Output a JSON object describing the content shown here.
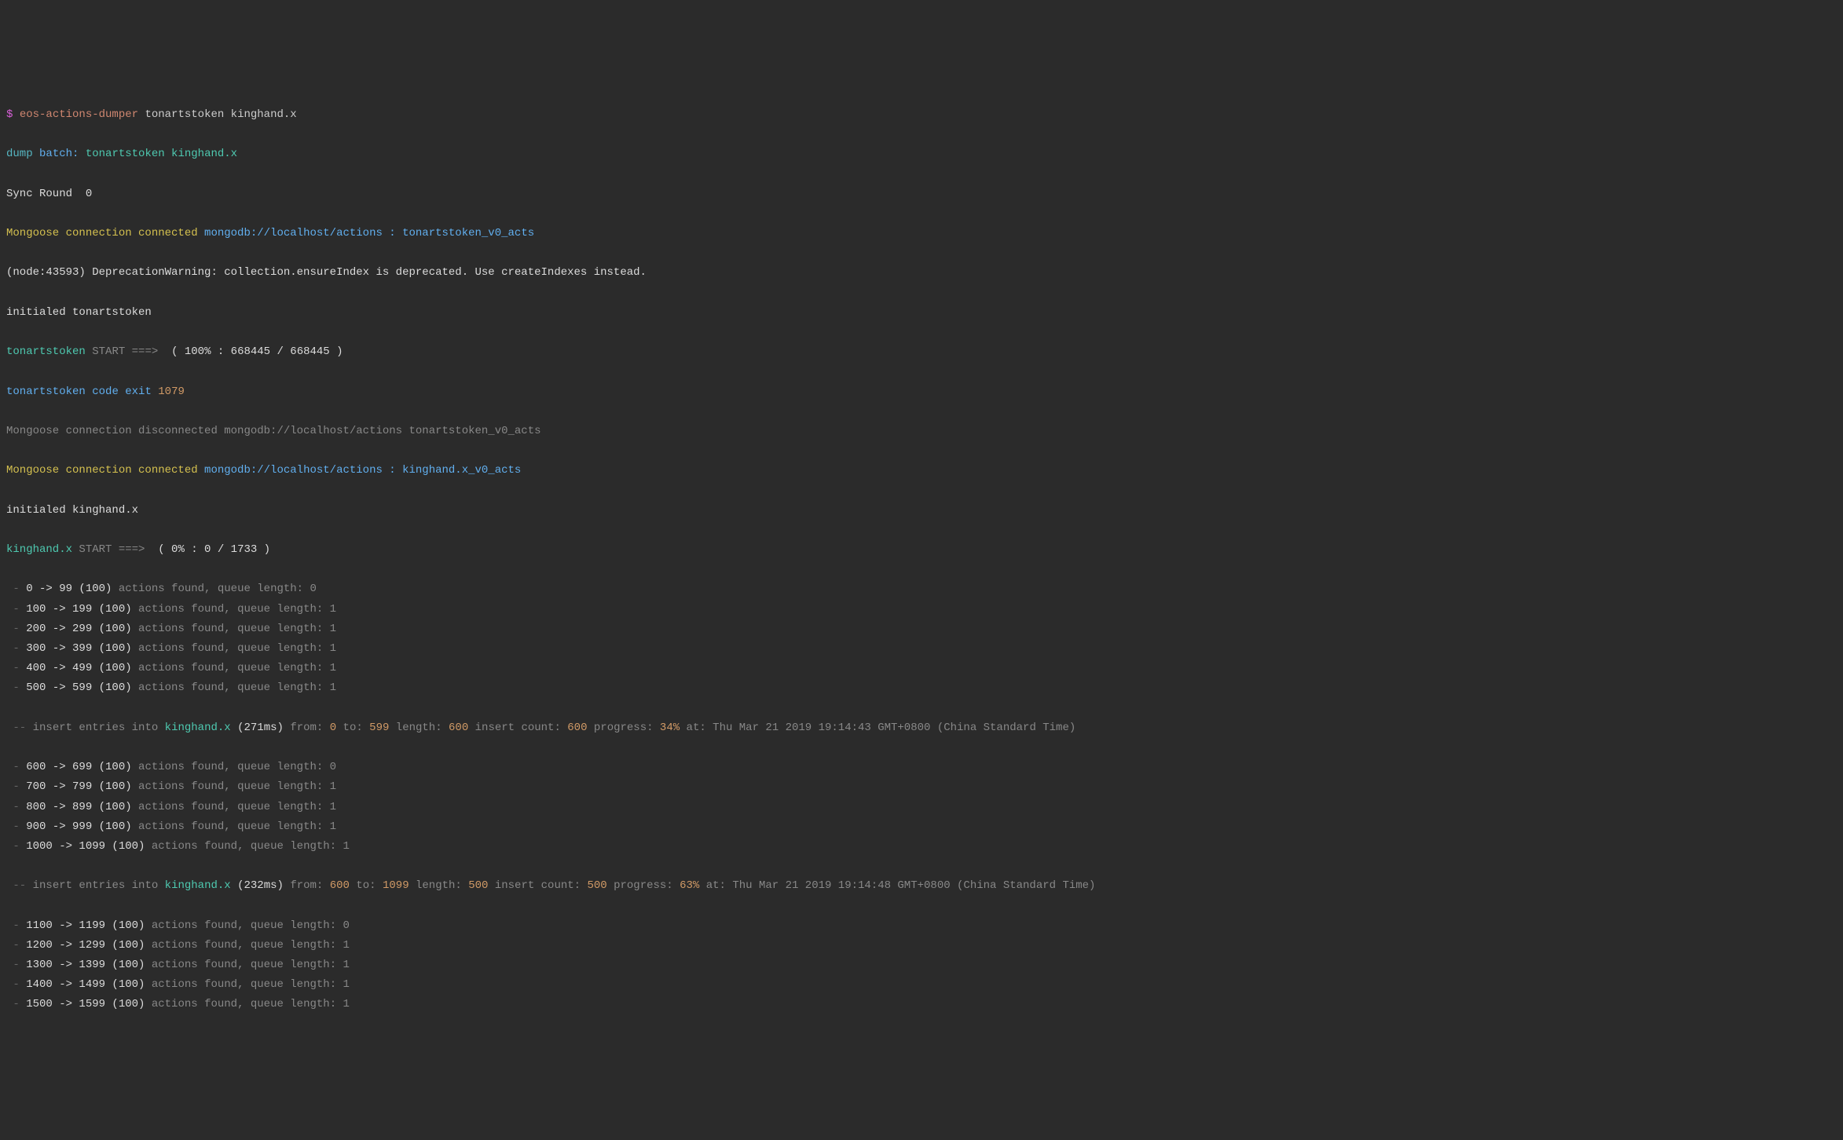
{
  "prompt": "$",
  "command": "eos-actions-dumper",
  "cmdArgs": "tonartstoken kinghand.x",
  "dumpBatch": {
    "dump": "dump",
    "batch": "batch:",
    "args": "tonartstoken kinghand.x"
  },
  "syncRound": "Sync Round  0",
  "conn1": {
    "prefix": "Mongoose connection connected",
    "url": "mongodb://localhost/actions : tonartstoken_v0_acts"
  },
  "deprecation": "(node:43593) DeprecationWarning: collection.ensureIndex is deprecated. Use createIndexes instead.",
  "initialed1": "initialed tonartstoken",
  "token1": {
    "name": "tonartstoken",
    "start": "START ===>",
    "progress": "( 100% : 668445 / 668445 )"
  },
  "exit": {
    "name": "tonartstoken",
    "label": "code exit",
    "code": "1079"
  },
  "disconn": "Mongoose connection disconnected mongodb://localhost/actions tonartstoken_v0_acts",
  "conn2": {
    "prefix": "Mongoose connection connected",
    "url": "mongodb://localhost/actions : kinghand.x_v0_acts"
  },
  "initialed2": "initialed kinghand.x",
  "token2": {
    "name": "kinghand.x",
    "start": "START ===>",
    "progress": "( 0% : 0 / 1733 )"
  },
  "ranges": [
    {
      "dash": " -",
      "range": "0 -> 99 (100)",
      "suffix": "actions found, queue length: 0"
    },
    {
      "dash": " -",
      "range": "100 -> 199 (100)",
      "suffix": "actions found, queue length: 1"
    },
    {
      "dash": " -",
      "range": "200 -> 299 (100)",
      "suffix": "actions found, queue length: 1"
    },
    {
      "dash": " -",
      "range": "300 -> 399 (100)",
      "suffix": "actions found, queue length: 1"
    },
    {
      "dash": " -",
      "range": "400 -> 499 (100)",
      "suffix": "actions found, queue length: 1"
    },
    {
      "dash": " -",
      "range": "500 -> 599 (100)",
      "suffix": "actions found, queue length: 1"
    }
  ],
  "insert1": {
    "dash": " --",
    "prefix": "insert entries into",
    "name": "kinghand.x",
    "timing": "(271ms)",
    "fromLabel": "from:",
    "fromVal": "0",
    "toLabel": "to:",
    "toVal": "599",
    "lengthLabel": "length:",
    "lengthVal": "600",
    "countLabel": "insert count:",
    "countVal": "600",
    "progressLabel": "progress:",
    "progressVal": "34%",
    "atLabel": "at:",
    "time": "Thu Mar 21 2019 19:14:43 GMT+0800 (China Standard Time)"
  },
  "ranges2": [
    {
      "dash": " -",
      "range": "600 -> 699 (100)",
      "suffix": "actions found, queue length: 0"
    },
    {
      "dash": " -",
      "range": "700 -> 799 (100)",
      "suffix": "actions found, queue length: 1"
    },
    {
      "dash": " -",
      "range": "800 -> 899 (100)",
      "suffix": "actions found, queue length: 1"
    },
    {
      "dash": " -",
      "range": "900 -> 999 (100)",
      "suffix": "actions found, queue length: 1"
    },
    {
      "dash": " -",
      "range": "1000 -> 1099 (100)",
      "suffix": "actions found, queue length: 1"
    }
  ],
  "insert2": {
    "dash": " --",
    "prefix": "insert entries into",
    "name": "kinghand.x",
    "timing": "(232ms)",
    "fromLabel": "from:",
    "fromVal": "600",
    "toLabel": "to:",
    "toVal": "1099",
    "lengthLabel": "length:",
    "lengthVal": "500",
    "countLabel": "insert count:",
    "countVal": "500",
    "progressLabel": "progress:",
    "progressVal": "63%",
    "atLabel": "at:",
    "time": "Thu Mar 21 2019 19:14:48 GMT+0800 (China Standard Time)"
  },
  "ranges3": [
    {
      "dash": " -",
      "range": "1100 -> 1199 (100)",
      "suffix": "actions found, queue length: 0"
    },
    {
      "dash": " -",
      "range": "1200 -> 1299 (100)",
      "suffix": "actions found, queue length: 1"
    },
    {
      "dash": " -",
      "range": "1300 -> 1399 (100)",
      "suffix": "actions found, queue length: 1"
    },
    {
      "dash": " -",
      "range": "1400 -> 1499 (100)",
      "suffix": "actions found, queue length: 1"
    },
    {
      "dash": " -",
      "range": "1500 -> 1599 (100)",
      "suffix": "actions found, queue length: 1"
    }
  ]
}
